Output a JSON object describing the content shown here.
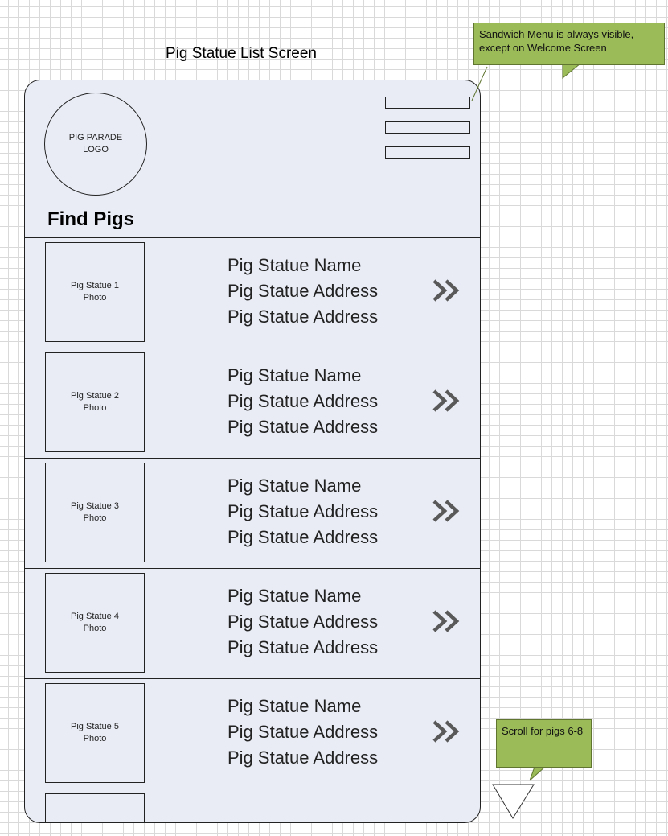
{
  "title": "Pig Statue List Screen",
  "logo_text": "PIG PARADE\nLOGO",
  "header_title": "Find Pigs",
  "menu": {
    "icon": "hamburger-menu-icon"
  },
  "rows": [
    {
      "photo_label": "Pig Statue 1\nPhoto",
      "name": "Pig Statue Name",
      "address1": "Pig Statue Address",
      "address2": "Pig Statue Address"
    },
    {
      "photo_label": "Pig Statue 2\nPhoto",
      "name": "Pig Statue Name",
      "address1": "Pig Statue Address",
      "address2": "Pig Statue Address"
    },
    {
      "photo_label": "Pig Statue 3\nPhoto",
      "name": "Pig Statue Name",
      "address1": "Pig Statue Address",
      "address2": "Pig Statue Address"
    },
    {
      "photo_label": "Pig Statue 4\nPhoto",
      "name": "Pig Statue Name",
      "address1": "Pig Statue Address",
      "address2": "Pig Statue Address"
    },
    {
      "photo_label": "Pig Statue 5\nPhoto",
      "name": "Pig Statue Name",
      "address1": "Pig Statue Address",
      "address2": "Pig Statue Address"
    }
  ],
  "callouts": {
    "menu_note": "Sandwich Menu is always visible, except on Welcome Screen",
    "scroll_note": "Scroll for pigs 6-8"
  },
  "colors": {
    "screen_bg": "#e9ecf5",
    "callout_bg": "#9bbb59",
    "chevron": "#595959"
  }
}
